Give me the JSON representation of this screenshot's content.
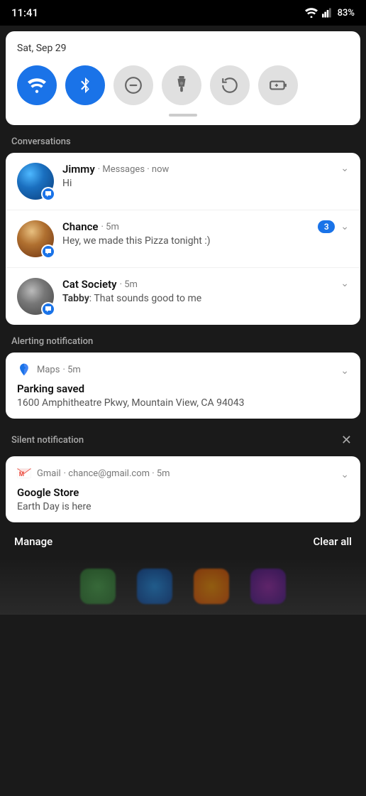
{
  "statusBar": {
    "time": "11:41",
    "battery": "83%",
    "batteryIcon": "battery-icon",
    "signalIcon": "signal-icon",
    "wifiIcon": "wifi-status-icon"
  },
  "quickSettings": {
    "date": "Sat, Sep 29",
    "buttons": [
      {
        "id": "wifi",
        "label": "Wi-Fi",
        "active": true,
        "icon": "wifi-icon"
      },
      {
        "id": "bluetooth",
        "label": "Bluetooth",
        "active": true,
        "icon": "bluetooth-icon"
      },
      {
        "id": "dnd",
        "label": "Do Not Disturb",
        "active": false,
        "icon": "dnd-icon"
      },
      {
        "id": "flashlight",
        "label": "Flashlight",
        "active": false,
        "icon": "flashlight-icon"
      },
      {
        "id": "rotate",
        "label": "Auto-rotate",
        "active": false,
        "icon": "rotate-icon"
      },
      {
        "id": "battery-saver",
        "label": "Battery Saver",
        "active": false,
        "icon": "battery-saver-icon"
      }
    ]
  },
  "sections": {
    "conversations": {
      "label": "Conversations",
      "items": [
        {
          "name": "Jimmy",
          "app": "Messages",
          "time": "now",
          "preview": "Hi",
          "unread": null,
          "avatar": "jimmy"
        },
        {
          "name": "Chance",
          "app": null,
          "time": "5m",
          "preview": "Hey, we made this Pizza tonight :)",
          "unread": 3,
          "avatar": "chance"
        },
        {
          "name": "Cat Society",
          "app": null,
          "time": "5m",
          "previewSender": "Tabby",
          "preview": "That sounds good to me",
          "unread": null,
          "avatar": "cat"
        }
      ]
    },
    "alerting": {
      "label": "Alerting notification",
      "notification": {
        "app": "Maps",
        "time": "5m",
        "title": "Parking saved",
        "body": "1600 Amphitheatre Pkwy, Mountain View, CA 94043"
      }
    },
    "silent": {
      "label": "Silent notification",
      "notification": {
        "app": "Gmail",
        "email": "chance@gmail.com",
        "time": "5m",
        "title": "Google Store",
        "body": "Earth Day is here"
      }
    }
  },
  "footer": {
    "manage": "Manage",
    "clearAll": "Clear all"
  }
}
